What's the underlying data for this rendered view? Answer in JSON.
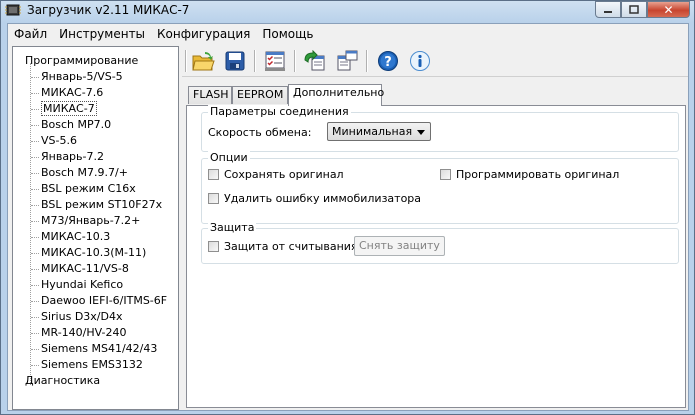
{
  "window": {
    "title": "Загрузчик v2.11 МИКАС-7",
    "minimize_icon": "minimize-icon",
    "maximize_icon": "maximize-icon",
    "close_glyph": "✕"
  },
  "menu": [
    {
      "label": "Файл"
    },
    {
      "label": "Инструменты"
    },
    {
      "label": "Конфигурация"
    },
    {
      "label": "Помощь"
    }
  ],
  "tree": {
    "root": "Программирование",
    "children": [
      "Январь-5/VS-5",
      "МИКАС-7.6",
      "МИКАС-7",
      "Bosch MP7.0",
      "VS-5.6",
      "Январь-7.2",
      "Bosch M7.9.7/+",
      "BSL режим C16x",
      "BSL режим ST10F27x",
      "M73/Январь-7.2+",
      "МИКАС-10.3",
      "МИКАС-10.3(M-11)",
      "МИКАС-11/VS-8",
      "Hyundai Kefico",
      "Daewoo IEFI-6/ITMS-6F",
      "Sirius D3x/D4x",
      "MR-140/HV-240",
      "Siemens MS41/42/43",
      "Siemens EMS3132"
    ],
    "selected": "МИКАС-7",
    "last_root": "Диагностика"
  },
  "toolbar": [
    {
      "icon": "open-folder-icon"
    },
    {
      "icon": "save-icon"
    },
    {
      "icon": "settings-checklist-icon"
    },
    {
      "icon": "read-ecu-icon"
    },
    {
      "icon": "write-ecu-icon"
    },
    {
      "icon": "help-icon"
    },
    {
      "icon": "info-icon"
    }
  ],
  "tabs": [
    "FLASH",
    "EEPROM",
    "Дополнительно"
  ],
  "active_tab": "Дополнительно",
  "connection": {
    "title": "Параметры соединения",
    "speed_label": "Скорость обмена:",
    "speed_value": "Минимальная"
  },
  "options": {
    "title": "Опции",
    "save_original": "Сохранять оригинал",
    "program_original": "Программировать оригинал",
    "clear_immo": "Удалить ошибку иммобилизатора"
  },
  "protection": {
    "title": "Защита",
    "read_protect": "Защита от считывания",
    "remove_button": "Снять защиту"
  },
  "colors": {
    "title_gradient_top": "#cfe0f1",
    "close_red": "#c8452f",
    "help_blue": "#1a5fb4"
  }
}
